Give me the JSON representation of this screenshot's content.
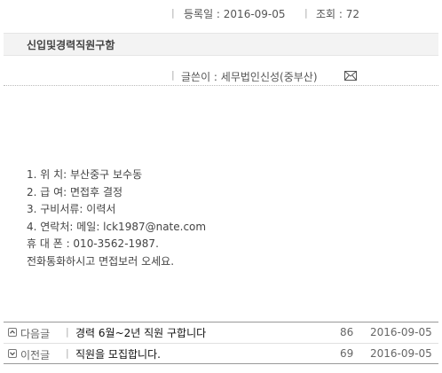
{
  "post": {
    "date_label": "등록일 : 2016-09-05",
    "views_label": "조회 : 72",
    "title": "신입및경력직원구함",
    "author_label": "글쓴이 : 세무법인신성(중부산)",
    "content_lines": [
      "1. 위 치: 부산중구 보수동",
      "2. 급 여: 면접후 결정",
      "3. 구비서류: 이력서",
      "4. 연락처: 메일: lck1987@nate.com",
      "휴 대 폰 : 010-3562-1987.",
      "전화통화하시고 면접보러 오세요."
    ]
  },
  "navigation": {
    "next": {
      "kind": "다음글",
      "subject": "경력 6월~2년 직원 구합니다",
      "hits": "86",
      "date": "2016-09-05"
    },
    "prev": {
      "kind": "이전글",
      "subject": "직원을 모집합니다.",
      "hits": "69",
      "date": "2016-09-05"
    }
  },
  "icons": {
    "mail": "mail-icon",
    "next_arrow": "chevron-up-icon",
    "prev_arrow": "chevron-down-icon"
  }
}
